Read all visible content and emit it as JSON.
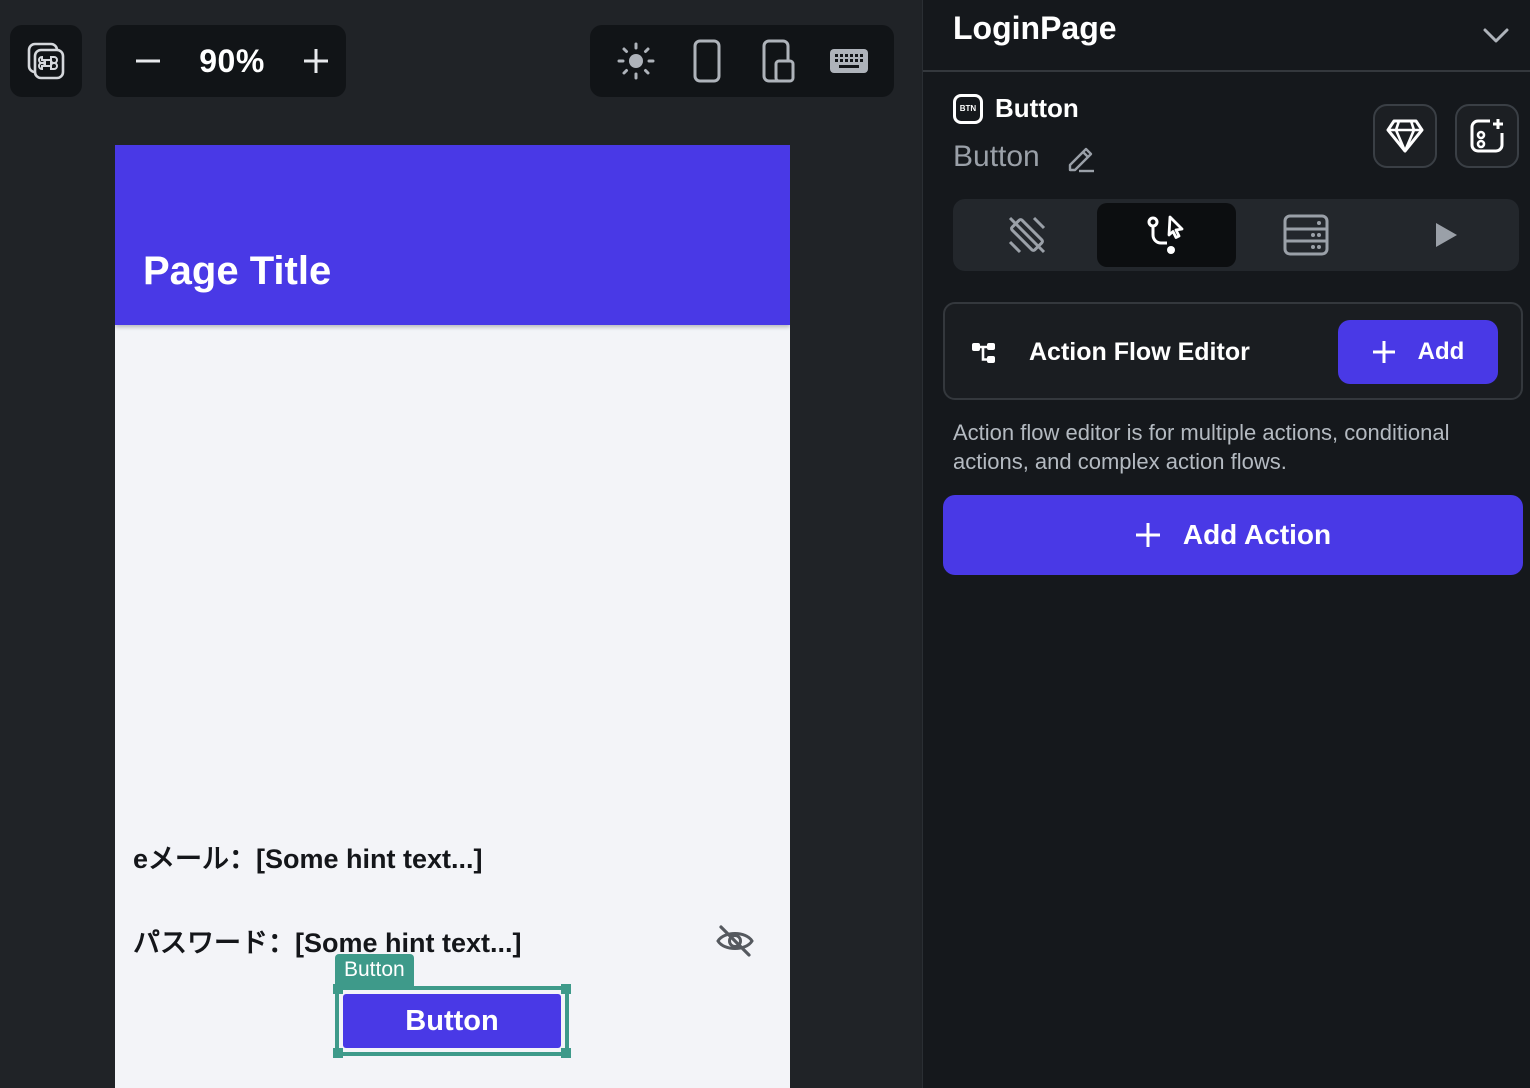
{
  "toolbar": {
    "command_icon": "command-palette-icon",
    "zoom": {
      "minus_icon": "minus-icon",
      "value": "90%",
      "plus_icon": "plus-icon"
    },
    "device_icons": [
      "light-mode-icon",
      "phone-icon",
      "tablet-icon",
      "keyboard-icon"
    ]
  },
  "preview": {
    "accent": "#4939e6",
    "page_title": "Page Title",
    "email_line": "eメール：[Some hint text...]",
    "password_line": "パスワード：[Some hint text...]",
    "visibility_icon": "eye-off-icon",
    "selection_tag": "Button",
    "button_label": "Button"
  },
  "panel": {
    "page_name": "LoginPage",
    "widget_type_badge": "BTN",
    "widget_type": "Button",
    "widget_name": "Button",
    "tabs": [
      {
        "icon": "properties-icon",
        "active": false
      },
      {
        "icon": "actions-icon",
        "active": true
      },
      {
        "icon": "backend-query-icon",
        "active": false
      },
      {
        "icon": "animations-icon",
        "active": false
      }
    ],
    "action_flow": {
      "label": "Action Flow Editor",
      "add_label": "Add",
      "description": "Action flow editor is for multiple actions, conditional actions, and complex action flows."
    },
    "add_action_label": "Add Action"
  }
}
